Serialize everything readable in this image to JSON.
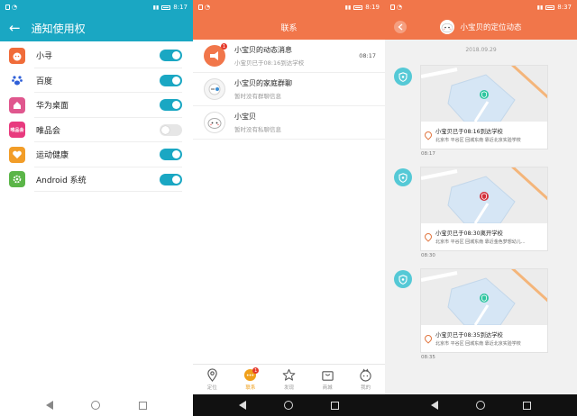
{
  "colors": {
    "teal": "#1aa7c3",
    "orange": "#f1764a",
    "badge": "#55c9d6",
    "green": "#2fc6a0",
    "red": "#d32f3a",
    "tab_active": "#f0a01a"
  },
  "panel1": {
    "status_time": "8:17",
    "title": "通知使用权",
    "apps": [
      {
        "name": "小寻",
        "icon": "xiaoxun-app-icon",
        "enabled": true
      },
      {
        "name": "百度",
        "icon": "baidu-app-icon",
        "enabled": true
      },
      {
        "name": "华为桌面",
        "icon": "huawei-launcher-icon",
        "enabled": true
      },
      {
        "name": "唯品会",
        "icon": "vipshop-app-icon",
        "icon_text": "唯品会",
        "enabled": false
      },
      {
        "name": "运动健康",
        "icon": "health-app-icon",
        "enabled": true
      },
      {
        "name": "Android 系统",
        "icon": "android-settings-icon",
        "enabled": true
      }
    ]
  },
  "panel2": {
    "status_time": "8:19",
    "title": "联系",
    "contacts": [
      {
        "name": "小宝贝的动态消息",
        "sub": "小宝贝已于08:16到达学校",
        "time": "08:17",
        "badge": "1"
      },
      {
        "name": "小宝贝的家庭群聊",
        "sub": "暂时没有群聊信息",
        "time": ""
      },
      {
        "name": "小宝贝",
        "sub": "暂时没有私聊信息",
        "time": ""
      }
    ],
    "tabs": [
      {
        "label": "定位",
        "icon": "location-pin-icon",
        "active": false
      },
      {
        "label": "联系",
        "icon": "chat-icon",
        "active": true,
        "badge": "1"
      },
      {
        "label": "发现",
        "icon": "star-icon",
        "active": false
      },
      {
        "label": "商城",
        "icon": "shopping-bag-icon",
        "active": false
      },
      {
        "label": "我的",
        "icon": "profile-icon",
        "active": false
      }
    ]
  },
  "panel3": {
    "status_time": "8:37",
    "title": "小宝贝的定位动态",
    "date": "2018.09.29",
    "events": [
      {
        "title": "小宝贝已于08:16到达学校",
        "address": "北京市 平谷区 回城东南 靠近北京实验学校",
        "time": "08:17",
        "status": "arrive"
      },
      {
        "title": "小宝贝已于08:30离开学校",
        "address": "北京市 平谷区 回城东南 靠近金色梦想幼儿...",
        "time": "08:30",
        "status": "leave"
      },
      {
        "title": "小宝贝已于08:35到达学校",
        "address": "北京市 平谷区 回城东南 靠近北京实验学校",
        "time": "08:35",
        "status": "arrive"
      }
    ]
  }
}
